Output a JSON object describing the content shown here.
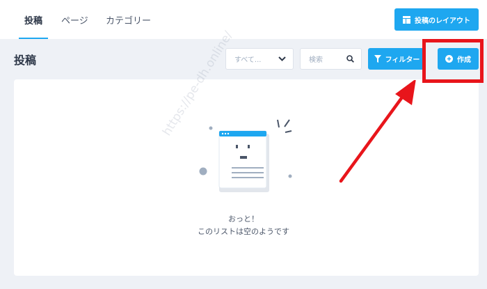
{
  "tabs": [
    {
      "label": "投稿",
      "active": true
    },
    {
      "label": "ページ",
      "active": false
    },
    {
      "label": "カテゴリー",
      "active": false
    }
  ],
  "header": {
    "layout_button": "投稿のレイアウト"
  },
  "page": {
    "title": "投稿"
  },
  "toolbar": {
    "select_value": "すべて...",
    "search_placeholder": "検索",
    "filter_label": "フィルター",
    "create_label": "作成"
  },
  "empty_state": {
    "line1": "おっと！",
    "line2": "このリストは空のようです"
  },
  "watermark": "https://pe-dh.online/",
  "icons": {
    "layout": "layout-icon",
    "dropdown": "chevron-down-icon",
    "search": "search-icon",
    "filter": "filter-icon",
    "create": "plus-circle-icon"
  },
  "colors": {
    "accent": "#1ea7f0",
    "background": "#eef1f6",
    "annotation": "#e8151b"
  }
}
